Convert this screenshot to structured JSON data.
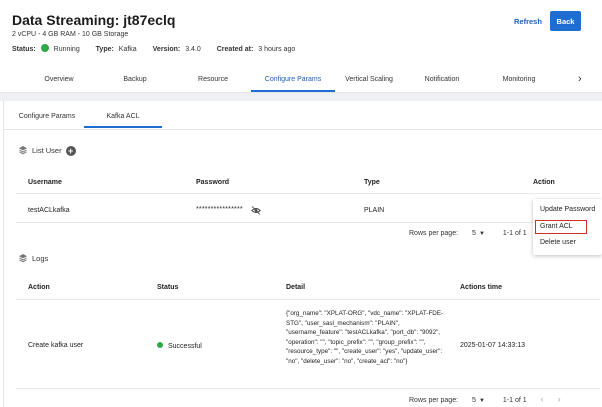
{
  "header": {
    "title": "Data Streaming: jt87eclq",
    "specs": "2 vCPU - 4 GB RAM - 10 GB Storage",
    "status_label": "Status:",
    "status_value": "Running",
    "type_label": "Type:",
    "type_value": "Kafka",
    "version_label": "Version:",
    "version_value": "3.4.0",
    "created_label": "Created at:",
    "created_value": "3 hours ago",
    "refresh_label": "Refresh",
    "back_label": "Back"
  },
  "nav": {
    "tabs": [
      "Overview",
      "Backup",
      "Resource",
      "Configure Params",
      "Vertical Scaling",
      "Notification",
      "Monitoring"
    ],
    "active": "Configure Params",
    "next_icon": "›"
  },
  "subtabs": {
    "items": [
      "Configure Params",
      "Kafka ACL"
    ],
    "active": "Kafka ACL"
  },
  "users": {
    "section_title": "List User",
    "columns": [
      "Username",
      "Password",
      "Type",
      "Action"
    ],
    "rows": [
      {
        "username": "testACLkafka",
        "password": "****************",
        "type": "PLAIN"
      }
    ],
    "pager": {
      "rows_label": "Rows per page:",
      "rows_value": "5",
      "range": "1-1 of 1"
    }
  },
  "action_menu": {
    "items": [
      "Update Password",
      "Grant ACL",
      "Delete user"
    ],
    "highlighted": "Grant ACL"
  },
  "logs": {
    "section_title": "Logs",
    "columns": [
      "Action",
      "Status",
      "Detail",
      "Actions time"
    ],
    "rows": [
      {
        "action": "Create kafka user",
        "status": "Successful",
        "detail": "{\"org_name\": \"XPLAT-ORG\", \"vdc_name\": \"XPLAT-FDE-STG\", \"user_sasl_mechanism\": \"PLAIN\", \"username_feature\": \"testACLkafka\", \"port_db\": \"9092\", \"operation\": \"\", \"topic_prefix\": \"\", \"group_prefix\": \"\", \"resource_type\": \"\", \"create_user\": \"yes\", \"update_user\": \"no\", \"delete_user\": \"no\", \"create_acl\": \"no\"}",
        "time": "2025-01-07 14:33:13"
      }
    ],
    "pager": {
      "rows_label": "Rows per page:",
      "rows_value": "5",
      "range": "1-1 of 1"
    }
  },
  "colors": {
    "accent": "#1f6dd1",
    "success": "#2eaa48",
    "highlight": "#d42b2b"
  },
  "icons": [
    "layers-icon",
    "add-circle-icon",
    "eye-off-icon",
    "more-vert-icon",
    "chevron-right-icon",
    "chevron-left-icon"
  ]
}
